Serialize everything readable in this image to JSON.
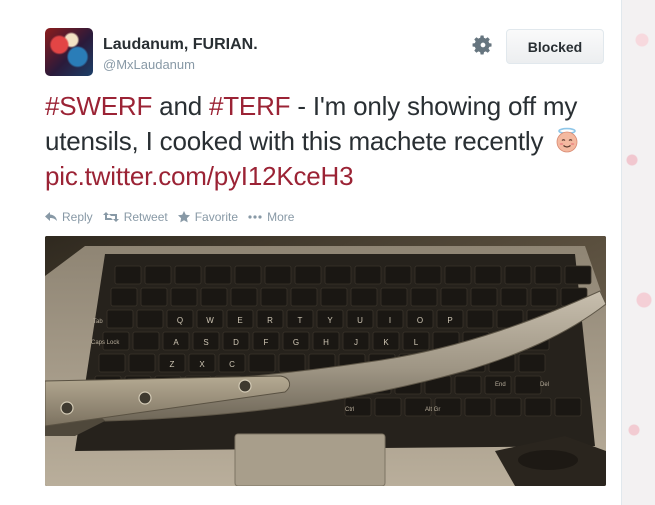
{
  "tweet": {
    "display_name": "Laudanum, FURIAN.",
    "screen_name": "@MxLaudanum",
    "block_button_label": "Blocked",
    "text_parts": {
      "hashtag1": "#SWERF",
      "and": " and ",
      "hashtag2": "#TERF",
      "body": " - I'm only showing off my utensils, I cooked with this machete recently",
      "link": "pic.twitter.com/pyI12KceH3"
    },
    "emoji": "smiling-face-with-halo"
  },
  "actions": {
    "reply": "Reply",
    "retweet": "Retweet",
    "favorite": "Favorite",
    "more": "More"
  },
  "icons": {
    "settings": "gear-icon",
    "reply": "reply-icon",
    "retweet": "retweet-icon",
    "favorite": "star-icon",
    "more": "ellipsis-icon"
  },
  "colors": {
    "link": "#9b2335",
    "text": "#292f33",
    "muted": "#8899a6",
    "border": "#e1e8ed"
  },
  "media": {
    "subject": "machete-on-laptop-keyboard",
    "keys_row1": [
      "Q",
      "W",
      "E",
      "R",
      "T",
      "Y",
      "U",
      "I",
      "O",
      "P"
    ],
    "keys_row2": [
      "A",
      "S",
      "D",
      "F",
      "G",
      "H",
      "J",
      "K",
      "L"
    ],
    "keys_row3": [
      "Z",
      "X",
      "C"
    ],
    "key_labels": [
      "Tab",
      "Caps Lock",
      "Alt Gr",
      "Ctrl",
      "End",
      "Del"
    ]
  }
}
